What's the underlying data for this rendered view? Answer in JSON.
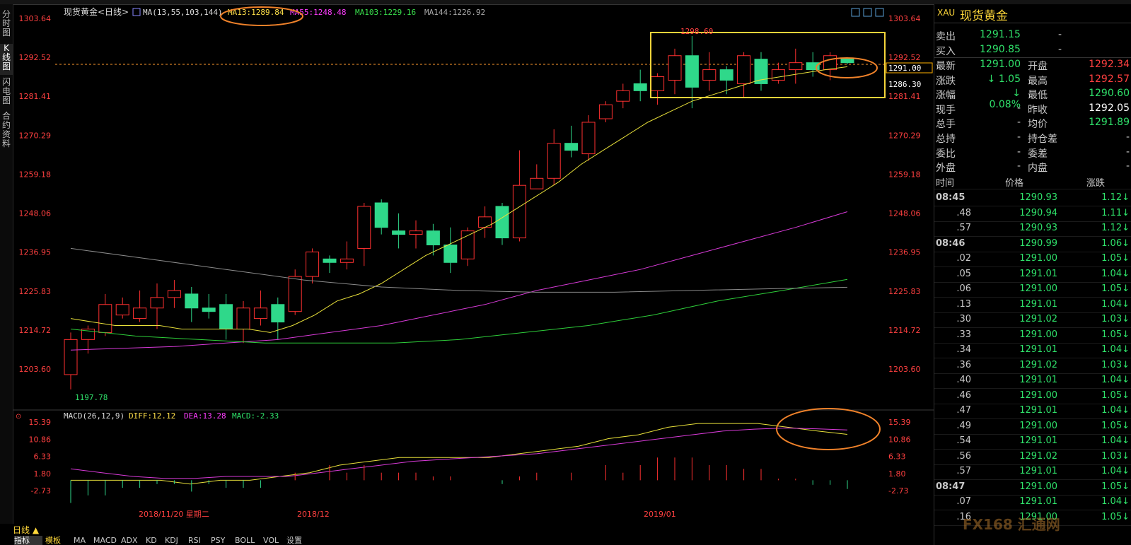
{
  "left_tabs": [
    "分时图",
    "K线图",
    "闪电图",
    "合约资料"
  ],
  "header": {
    "title": "现货黄金<日线>",
    "ma_label": "MA(13,55,103,144)",
    "ma13": "MA13:1289.84",
    "ma55": "MA55:1248.48",
    "ma103": "MA103:1229.16",
    "ma144": "MA144:1226.92"
  },
  "price_axis": [
    "1303.64",
    "1292.52",
    "1281.41",
    "1270.29",
    "1259.18",
    "1248.06",
    "1236.95",
    "1225.83",
    "1214.72",
    "1203.60"
  ],
  "price_tags": {
    "last": "1291.00",
    "ma13": "1286.30",
    "high": "1298.60",
    "low": "1197.78"
  },
  "macd": {
    "label": "MACD(26,12,9)",
    "diff": "DIFF:12.12",
    "dea": "DEA:13.28",
    "macd": "MACD:-2.33",
    "axis": [
      "15.39",
      "10.86",
      "6.33",
      "1.80",
      "-2.73"
    ]
  },
  "date_labels": [
    "2018/11/20 星期二",
    "2018/12",
    "2019/01"
  ],
  "period": "日线 ▲",
  "bottom_tabs": [
    "指标",
    "模板",
    "MA",
    "MACD",
    "ADX",
    "KD",
    "KDJ",
    "RSI",
    "PSY",
    "BOLL",
    "VOL",
    "设置"
  ],
  "chart_data": {
    "type": "candlestick",
    "series": [
      {
        "name": "candles",
        "values": [
          [
            1202,
            1212,
            1197.78,
            1214
          ],
          [
            1212,
            1215,
            1208,
            1216
          ],
          [
            1214,
            1222,
            1213,
            1225
          ],
          [
            1219,
            1222,
            1218,
            1224
          ],
          [
            1218,
            1221,
            1217,
            1226
          ],
          [
            1221,
            1224,
            1215,
            1228
          ],
          [
            1224,
            1226,
            1221,
            1229
          ],
          [
            1225,
            1221,
            1217,
            1227
          ],
          [
            1221,
            1220,
            1218,
            1225
          ],
          [
            1222,
            1215,
            1212,
            1225
          ],
          [
            1215,
            1221,
            1211,
            1223
          ],
          [
            1218,
            1221,
            1216,
            1226
          ],
          [
            1222,
            1217,
            1212,
            1224
          ],
          [
            1220,
            1230,
            1219,
            1232
          ],
          [
            1230,
            1237,
            1228,
            1238
          ],
          [
            1235,
            1234,
            1231,
            1236
          ],
          [
            1234,
            1235,
            1232,
            1240
          ],
          [
            1238,
            1250,
            1233,
            1251
          ],
          [
            1251,
            1244,
            1242,
            1252
          ],
          [
            1243,
            1242,
            1238,
            1248
          ],
          [
            1242,
            1243,
            1238,
            1246
          ],
          [
            1243,
            1239,
            1236,
            1245
          ],
          [
            1239,
            1234,
            1231,
            1244
          ],
          [
            1235,
            1243,
            1233,
            1244
          ],
          [
            1244,
            1247,
            1241,
            1250
          ],
          [
            1250,
            1241,
            1239,
            1251
          ],
          [
            1241,
            1256,
            1240,
            1266
          ],
          [
            1255,
            1258,
            1255,
            1262
          ],
          [
            1258,
            1268,
            1256,
            1272
          ],
          [
            1268,
            1266,
            1264,
            1273
          ],
          [
            1265,
            1274,
            1263,
            1276
          ],
          [
            1275,
            1279,
            1274,
            1280
          ],
          [
            1280,
            1283,
            1278,
            1285
          ],
          [
            1285,
            1283,
            1280,
            1289
          ],
          [
            1283,
            1287,
            1279,
            1288
          ],
          [
            1286,
            1293,
            1282,
            1295
          ],
          [
            1293,
            1284,
            1278,
            1298.6
          ],
          [
            1286,
            1289,
            1283,
            1294
          ],
          [
            1289,
            1286,
            1282,
            1290
          ],
          [
            1285,
            1293,
            1281,
            1294
          ],
          [
            1292,
            1285,
            1283,
            1294
          ],
          [
            1286,
            1289,
            1285,
            1291
          ],
          [
            1289,
            1291,
            1285,
            1295
          ],
          [
            1291,
            1289,
            1287,
            1294
          ],
          [
            1289,
            1293,
            1286,
            1294
          ],
          [
            1292.34,
            1291,
            1290.6,
            1292.57
          ]
        ]
      },
      {
        "name": "MA13",
        "values": [
          1218,
          1217,
          1216,
          1216,
          1216,
          1215,
          1215,
          1215,
          1215,
          1214,
          1216,
          1219,
          1223,
          1225,
          1228,
          1232,
          1236,
          1239,
          1242,
          1245,
          1249,
          1253,
          1257,
          1262,
          1266,
          1270,
          1274,
          1277,
          1280,
          1282,
          1284,
          1286,
          1287,
          1288,
          1289,
          1289.84
        ]
      },
      {
        "name": "MA55",
        "values": [
          1209,
          1209.5,
          1210,
          1211,
          1212,
          1214,
          1216,
          1219,
          1222,
          1226,
          1229,
          1232,
          1236,
          1240,
          1244,
          1248.48
        ]
      },
      {
        "name": "MA103",
        "values": [
          1215,
          1213,
          1212,
          1211,
          1211,
          1211,
          1212,
          1214,
          1216,
          1219,
          1223,
          1226,
          1229.16
        ]
      },
      {
        "name": "MA144",
        "values": [
          1238,
          1235,
          1232,
          1229,
          1227,
          1226,
          1225.5,
          1225.5,
          1226,
          1226.5,
          1226.92
        ]
      },
      {
        "name": "DIFF",
        "values": [
          0,
          0,
          0,
          0,
          -1,
          0,
          0,
          1,
          2,
          4,
          5,
          6,
          6,
          6,
          6,
          7,
          8,
          9,
          11,
          12,
          14,
          15,
          15,
          15,
          14,
          13,
          12.12
        ]
      },
      {
        "name": "DEA",
        "values": [
          3,
          2,
          1,
          0.5,
          0.5,
          1,
          1,
          1,
          2,
          3,
          4,
          5,
          5.5,
          6,
          6.5,
          7,
          8,
          9,
          10,
          11,
          12,
          13,
          13.5,
          13.8,
          13.6,
          13.28
        ]
      }
    ],
    "ylim": [
      1195,
      1306
    ]
  },
  "right": {
    "code": "XAU",
    "name": "现货黄金",
    "sell_label": "卖出",
    "sell": "1291.15",
    "sell_vol": "-",
    "buy_label": "买入",
    "buy": "1290.85",
    "buy_vol": "-",
    "quote": [
      [
        "最新",
        "1291.00",
        "开盘",
        "1292.34"
      ],
      [
        "涨跌",
        "↓ 1.05",
        "最高",
        "1292.57"
      ],
      [
        "涨幅",
        "↓ 0.08%",
        "最低",
        "1290.60"
      ],
      [
        "现手",
        "-",
        "昨收",
        "1292.05"
      ],
      [
        "总手",
        "-",
        "均价",
        "1291.89"
      ],
      [
        "总持",
        "-",
        "持仓差",
        "-"
      ],
      [
        "委比",
        "-",
        "委差",
        "-"
      ],
      [
        "外盘",
        "-",
        "内盘",
        "-"
      ]
    ],
    "ticks_header": [
      "时间",
      "价格",
      "涨跌"
    ],
    "ticks": [
      [
        "08:45",
        "1290.93",
        "1.12↓"
      ],
      [
        ".48",
        "1290.94",
        "1.11↓"
      ],
      [
        ".57",
        "1290.93",
        "1.12↓"
      ],
      [
        "08:46",
        "1290.99",
        "1.06↓"
      ],
      [
        ".02",
        "1291.00",
        "1.05↓"
      ],
      [
        ".05",
        "1291.01",
        "1.04↓"
      ],
      [
        ".06",
        "1291.00",
        "1.05↓"
      ],
      [
        ".13",
        "1291.01",
        "1.04↓"
      ],
      [
        ".30",
        "1291.02",
        "1.03↓"
      ],
      [
        ".33",
        "1291.00",
        "1.05↓"
      ],
      [
        ".34",
        "1291.01",
        "1.04↓"
      ],
      [
        ".36",
        "1291.02",
        "1.03↓"
      ],
      [
        ".40",
        "1291.01",
        "1.04↓"
      ],
      [
        ".46",
        "1291.00",
        "1.05↓"
      ],
      [
        ".47",
        "1291.01",
        "1.04↓"
      ],
      [
        ".49",
        "1291.00",
        "1.05↓"
      ],
      [
        ".54",
        "1291.01",
        "1.04↓"
      ],
      [
        ".56",
        "1291.02",
        "1.03↓"
      ],
      [
        ".57",
        "1291.01",
        "1.04↓"
      ],
      [
        "08:47",
        "1291.00",
        "1.05↓"
      ],
      [
        ".07",
        "1291.01",
        "1.04↓"
      ],
      [
        ".16",
        "1291.00",
        "1.05↓"
      ]
    ],
    "watermark": "FX168 汇通网"
  }
}
